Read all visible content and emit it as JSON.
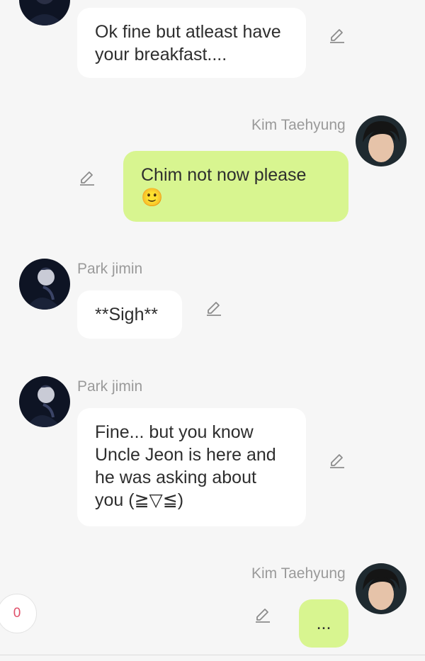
{
  "messages": [
    {
      "sender": "",
      "text": "Ok fine but atleast have your breakfast....",
      "side": "left"
    },
    {
      "sender": "Kim Taehyung",
      "text": "Chim not now please 🙂",
      "side": "right"
    },
    {
      "sender": "Park jimin",
      "text": "**Sigh**",
      "side": "left"
    },
    {
      "sender": "Park jimin",
      "text": "Fine... but you know Uncle Jeon is here and he was asking about you (≧▽≦)",
      "side": "left"
    },
    {
      "sender": "Kim Taehyung",
      "text": "...",
      "side": "right"
    }
  ],
  "counter": "0",
  "colors": {
    "background": "#f6f6f6",
    "left_bubble": "#ffffff",
    "right_bubble": "#d8f590",
    "sender_name": "#9a9a9a",
    "counter_text": "#e0506a"
  },
  "icons": {
    "edit": "pencil-edit-icon",
    "avatar_jimin": "avatar-park-jimin",
    "avatar_taehyung": "avatar-kim-taehyung"
  }
}
